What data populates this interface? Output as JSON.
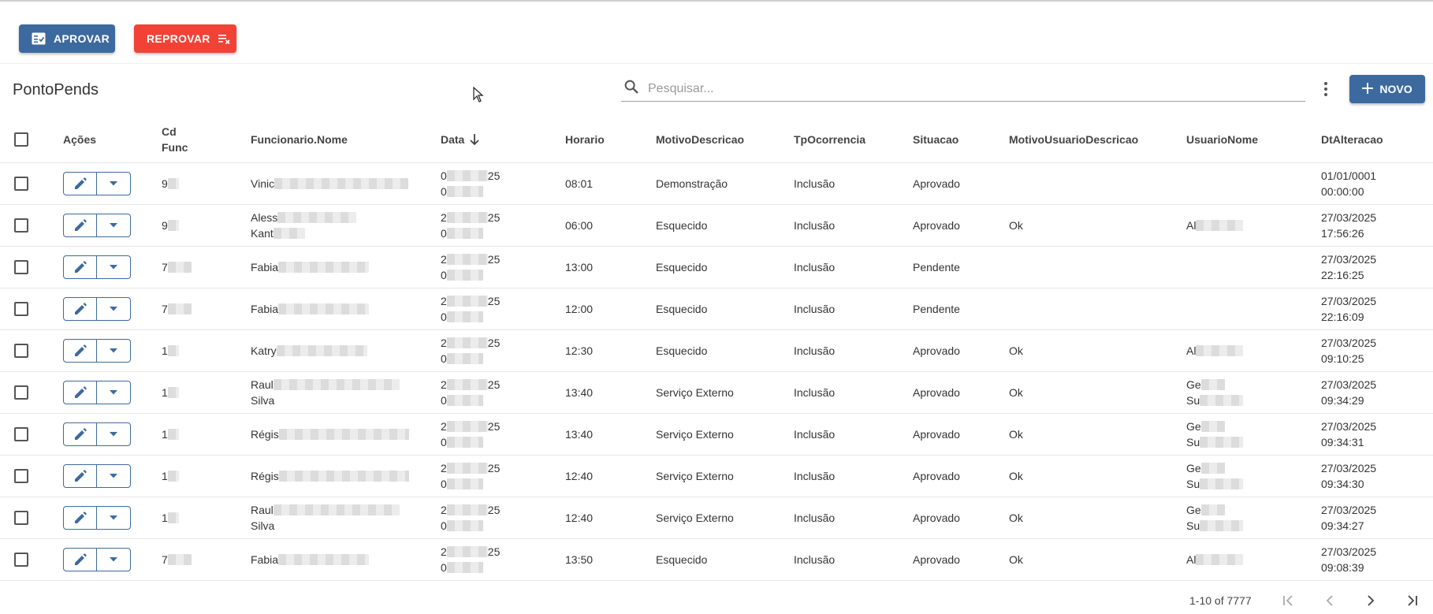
{
  "actions": {
    "approve_label": "APROVAR",
    "reject_label": "REPROVAR"
  },
  "page": {
    "title": "PontoPends"
  },
  "search": {
    "placeholder": "Pesquisar..."
  },
  "toolbar": {
    "new_label": "NOVO"
  },
  "table": {
    "columns": {
      "acoes": "Ações",
      "cd_func_1": "Cd",
      "cd_func_2": "Func",
      "funcionario": "Funcionario.Nome",
      "data": "Data",
      "horario": "Horario",
      "motivo": "MotivoDescricao",
      "tp": "TpOcorrencia",
      "situacao": "Situacao",
      "motivo_usuario": "MotivoUsuarioDescricao",
      "usuario": "UsuarioNome",
      "dt_alteracao": "DtAlteracao"
    },
    "rows": [
      {
        "cd": "9",
        "func1": "Vinic",
        "func2": "",
        "data1": "0",
        "data1b": "25",
        "data2": "0",
        "horario": "08:01",
        "motivo": "Demonstração",
        "tp": "Inclusão",
        "situacao": "Aprovado",
        "motivo_usuario": "",
        "usuario1": "",
        "usuario2": "",
        "dt1": "01/01/0001",
        "dt2": "00:00:00"
      },
      {
        "cd": "9",
        "func1": "Aless",
        "func2": "Kant",
        "data1": "2",
        "data1b": "25",
        "data2": "0",
        "horario": "06:00",
        "motivo": "Esquecido",
        "tp": "Inclusão",
        "situacao": "Aprovado",
        "motivo_usuario": "Ok",
        "usuario1": "Al",
        "usuario2": "",
        "dt1": "27/03/2025",
        "dt2": "17:56:26"
      },
      {
        "cd": "7",
        "func1": "Fabia",
        "func2": "",
        "data1": "2",
        "data1b": "25",
        "data2": "0",
        "horario": "13:00",
        "motivo": "Esquecido",
        "tp": "Inclusão",
        "situacao": "Pendente",
        "motivo_usuario": "",
        "usuario1": "",
        "usuario2": "",
        "dt1": "27/03/2025",
        "dt2": "22:16:25"
      },
      {
        "cd": "7",
        "func1": "Fabia",
        "func2": "",
        "data1": "2",
        "data1b": "25",
        "data2": "0",
        "horario": "12:00",
        "motivo": "Esquecido",
        "tp": "Inclusão",
        "situacao": "Pendente",
        "motivo_usuario": "",
        "usuario1": "",
        "usuario2": "",
        "dt1": "27/03/2025",
        "dt2": "22:16:09"
      },
      {
        "cd": "1",
        "func1": "Katry",
        "func2": "",
        "data1": "2",
        "data1b": "25",
        "data2": "0",
        "horario": "12:30",
        "motivo": "Esquecido",
        "tp": "Inclusão",
        "situacao": "Aprovado",
        "motivo_usuario": "Ok",
        "usuario1": "Al",
        "usuario2": "",
        "dt1": "27/03/2025",
        "dt2": "09:10:25"
      },
      {
        "cd": "1",
        "func1": "Raul",
        "func2": "Silva",
        "data1": "2",
        "data1b": "25",
        "data2": "0",
        "horario": "13:40",
        "motivo": "Serviço Externo",
        "tp": "Inclusão",
        "situacao": "Aprovado",
        "motivo_usuario": "Ok",
        "usuario1": "Ge",
        "usuario2": "Su",
        "dt1": "27/03/2025",
        "dt2": "09:34:29"
      },
      {
        "cd": "1",
        "func1": "Régis",
        "func2": "",
        "data1": "2",
        "data1b": "25",
        "data2": "0",
        "horario": "13:40",
        "motivo": "Serviço Externo",
        "tp": "Inclusão",
        "situacao": "Aprovado",
        "motivo_usuario": "Ok",
        "usuario1": "Ge",
        "usuario2": "Su",
        "dt1": "27/03/2025",
        "dt2": "09:34:31"
      },
      {
        "cd": "1",
        "func1": "Régis",
        "func2": "",
        "data1": "2",
        "data1b": "25",
        "data2": "0",
        "horario": "12:40",
        "motivo": "Serviço Externo",
        "tp": "Inclusão",
        "situacao": "Aprovado",
        "motivo_usuario": "Ok",
        "usuario1": "Ge",
        "usuario2": "Su",
        "dt1": "27/03/2025",
        "dt2": "09:34:30"
      },
      {
        "cd": "1",
        "func1": "Raul",
        "func2": "Silva",
        "data1": "2",
        "data1b": "25",
        "data2": "0",
        "horario": "12:40",
        "motivo": "Serviço Externo",
        "tp": "Inclusão",
        "situacao": "Aprovado",
        "motivo_usuario": "Ok",
        "usuario1": "Ge",
        "usuario2": "Su",
        "dt1": "27/03/2025",
        "dt2": "09:34:27"
      },
      {
        "cd": "7",
        "func1": "Fabia",
        "func2": "",
        "data1": "2",
        "data1b": "25",
        "data2": "0",
        "horario": "13:50",
        "motivo": "Esquecido",
        "tp": "Inclusão",
        "situacao": "Aprovado",
        "motivo_usuario": "Ok",
        "usuario1": "Al",
        "usuario2": "",
        "dt1": "27/03/2025",
        "dt2": "09:08:39"
      }
    ]
  },
  "pagination": {
    "range": "1-10 of 7777"
  },
  "colors": {
    "primary": "#3d6a9e",
    "danger": "#f24236"
  },
  "icons": {
    "approve": "checklist-icon",
    "reject": "clear-list-icon",
    "search": "search-icon",
    "more": "more-vertical-icon",
    "new": "plus-icon",
    "edit": "pencil-icon",
    "dropdown": "caret-down-icon",
    "sort": "arrow-down-icon"
  }
}
